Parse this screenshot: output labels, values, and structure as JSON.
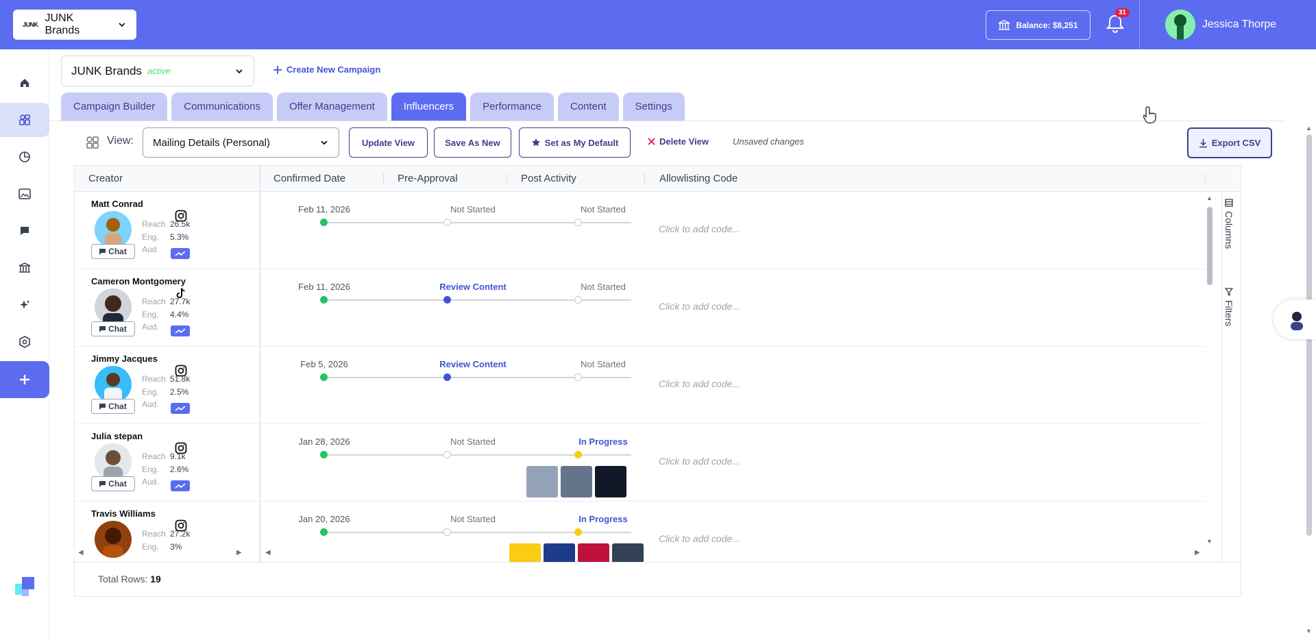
{
  "topbar": {
    "brand": "JUNK Brands",
    "brand_logo": "JUNK",
    "balance": "Balance: $8,251",
    "notification_count": "31",
    "user_name": "Jessica Thorpe"
  },
  "campaign": {
    "name": "JUNK Brands",
    "status": "active",
    "create_new": "Create New Campaign"
  },
  "tabs": [
    "Campaign Builder",
    "Communications",
    "Offer Management",
    "Influencers",
    "Performance",
    "Content",
    "Settings"
  ],
  "active_tab": "Influencers",
  "view_toolbar": {
    "view_label": "View:",
    "selected_view": "Mailing Details (Personal)",
    "update_view": "Update View",
    "save_as_new": "Save As New",
    "set_default": "Set as My Default",
    "delete_view": "Delete View",
    "unsaved": "Unsaved changes",
    "export_csv": "Export CSV"
  },
  "grid": {
    "columns": [
      "Creator",
      "Confirmed Date",
      "Pre-Approval",
      "Post Activity",
      "Allowlisting Code"
    ],
    "side_panels": [
      "Columns",
      "Filters"
    ],
    "stat_labels": [
      "Reach",
      "Eng.",
      "Aud."
    ],
    "chat_label": "Chat",
    "code_placeholder": "Click to add code...",
    "rows": [
      {
        "name": "Matt Conrad",
        "platform": "instagram-icon",
        "reach": "26.5k",
        "eng": "5.3%",
        "confirmed": "Feb 11, 2026",
        "pre_approval": "Not Started",
        "post_activity": "Not Started"
      },
      {
        "name": "Cameron Montgomery",
        "platform": "tiktok-icon",
        "reach": "27.7k",
        "eng": "4.4%",
        "confirmed": "Feb 11, 2026",
        "pre_approval": "Review Content",
        "post_activity": "Not Started"
      },
      {
        "name": "Jimmy Jacques",
        "platform": "instagram-icon",
        "reach": "51.8k",
        "eng": "2.5%",
        "confirmed": "Feb 5, 2026",
        "pre_approval": "Review Content",
        "post_activity": "Not Started"
      },
      {
        "name": "Julia stepan",
        "platform": "instagram-icon",
        "reach": "9.1k",
        "eng": "2.6%",
        "confirmed": "Jan 28, 2026",
        "pre_approval": "Not Started",
        "post_activity": "In Progress"
      },
      {
        "name": "Travis Williams",
        "platform": "instagram-icon",
        "reach": "27.2k",
        "eng": "3%",
        "confirmed": "Jan 20, 2026",
        "pre_approval": "Not Started",
        "post_activity": "In Progress"
      }
    ],
    "total_label": "Total Rows:",
    "total_value": "19"
  },
  "colors": {
    "primary": "#5b6cf0",
    "tab_inactive": "#c7ccf7",
    "status_done": "#22c55e",
    "status_review": "#4353d6",
    "status_progress": "#facc15"
  }
}
